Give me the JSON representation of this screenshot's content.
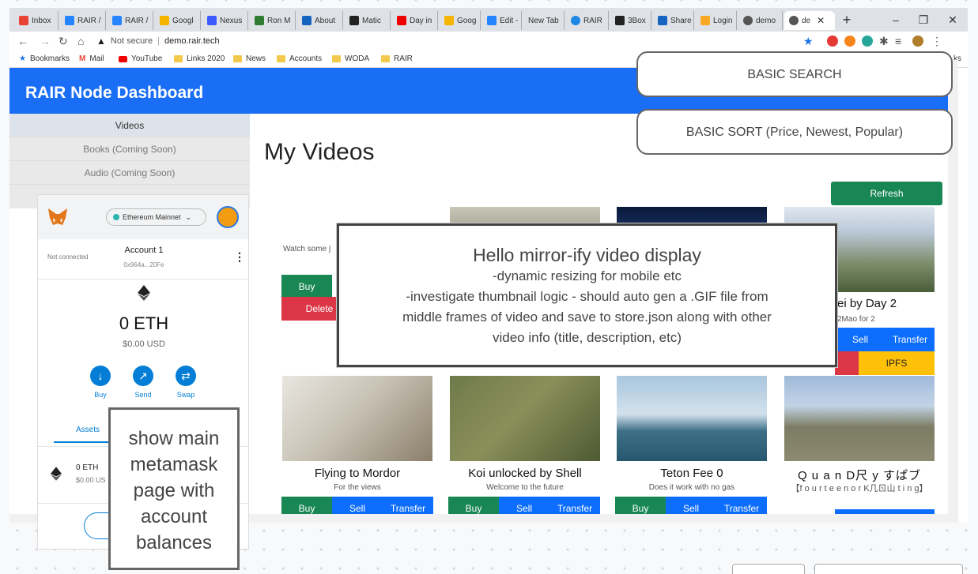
{
  "browser": {
    "tabs": [
      "Inbox",
      "RAIR /",
      "RAIR /",
      "Googl",
      "Nexus",
      "Ron M",
      "About",
      "Matic",
      "Day in",
      "Goog",
      "Edit -",
      "New Tab",
      "RAIR",
      "3Box",
      "Share",
      "Login",
      "demo",
      "de"
    ],
    "new_tab": "+",
    "url_warning": "Not secure",
    "url": "demo.rair.tech",
    "controls": {
      "minimize": "–",
      "restore": "❐",
      "close": "✕"
    }
  },
  "bookmarks": [
    "Bookmarks",
    "Mail",
    "YouTube",
    "Links 2020",
    "News",
    "Accounts",
    "WODA",
    "RAIR"
  ],
  "bookmarks_overflow": "ks",
  "app": {
    "title": "RAIR Node Dashboard",
    "sidebar": [
      "Videos",
      "Books (Coming Soon)",
      "Audio (Coming Soon)"
    ],
    "heading": "My Videos",
    "refresh": "Refresh",
    "watch_text": "Watch some j"
  },
  "videos_row1": [
    {
      "title": "ei by Day 2",
      "desc": "2Mao for 2"
    }
  ],
  "videos_row2": [
    {
      "title": "Flying to Mordor",
      "desc": "For the views"
    },
    {
      "title": "Koi unlocked by Shell",
      "desc": "Welcome to the future"
    },
    {
      "title": "Teton Fee 0",
      "desc": "Does it work with no gas"
    },
    {
      "title": "Q u a n D尺 y すぱブ",
      "desc": "【f o u r t e e n o r K几ㄖ山 t i n g】"
    }
  ],
  "buttons": {
    "buy": "Buy",
    "sell": "Sell",
    "transfer": "Transfer",
    "delete": "Delete",
    "ipfs": "IPFS"
  },
  "notes": {
    "search": "BASIC SEARCH",
    "sort": "BASIC SORT (Price, Newest, Popular)",
    "mirror_title": "Hello mirror-ify video display",
    "mirror_lines": [
      "-dynamic resizing for mobile etc",
      "-investigate thumbnail logic - should auto gen a .GIF file from",
      "middle frames of video and save to store.json along with other",
      "video info (title, description, etc)"
    ],
    "metamask": "show main metamask page with account balances"
  },
  "metamask": {
    "network": "Ethereum Mainnet",
    "status": "Not connected",
    "account": "Account 1",
    "address": "0x964a...20Fe",
    "balance": "0 ETH",
    "usd": "$0.00 USD",
    "actions": [
      "Buy",
      "Send",
      "Swap"
    ],
    "tab": "Assets",
    "asset_amount": "0 ETH",
    "asset_usd": "$0.00 US"
  }
}
